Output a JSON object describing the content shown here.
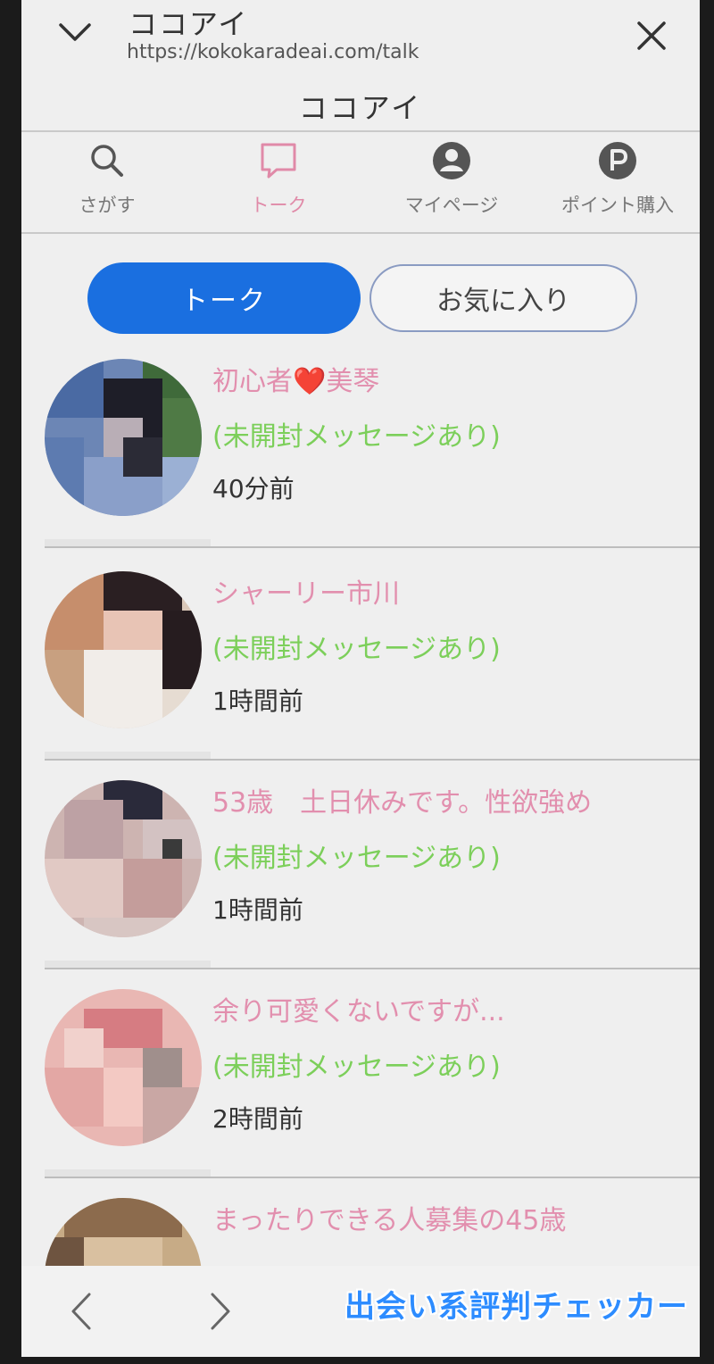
{
  "browser": {
    "site_title": "ココアイ",
    "url": "https://kokokaradeai.com/talk"
  },
  "page": {
    "title": "ココアイ"
  },
  "nav": {
    "items": [
      {
        "label": "さがす",
        "icon": "search-icon"
      },
      {
        "label": "トーク",
        "icon": "chat-icon",
        "active": true
      },
      {
        "label": "マイページ",
        "icon": "user-icon"
      },
      {
        "label": "ポイント購入",
        "icon": "points-icon"
      }
    ]
  },
  "tabs": {
    "talk": "トーク",
    "favorites": "お気に入り"
  },
  "talks": [
    {
      "name": "初心者❤️美琴",
      "status": "(未開封メッセージあり)",
      "time": "40分前"
    },
    {
      "name": "シャーリー市川",
      "status": "(未開封メッセージあり)",
      "time": "1時間前"
    },
    {
      "name": "53歳　土日休みです。性欲強め",
      "status": "(未開封メッセージあり)",
      "time": "1時間前"
    },
    {
      "name": "余り可愛くないですが...",
      "status": "(未開封メッセージあり)",
      "time": "2時間前"
    },
    {
      "name": "まったりできる人募集の45歳",
      "status": "",
      "time": ""
    }
  ],
  "watermark": "出会い系評判チェッカー",
  "colors": {
    "accent": "#1a6fe0",
    "name_pink": "#e28fae",
    "unread_green": "#7ccf5a"
  }
}
